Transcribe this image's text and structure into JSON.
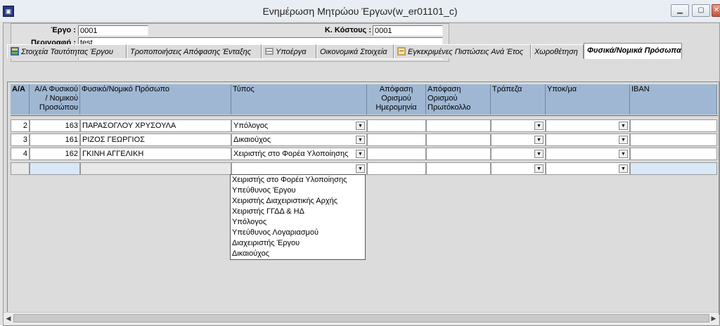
{
  "window": {
    "title": "Ενημέρωση Μητρώου Έργων(w_er01101_c)",
    "app_icon": "app-window-icon",
    "controls": [
      "minimize",
      "maximize",
      "close"
    ]
  },
  "header": {
    "ergo_label": "Έργο :",
    "ergo_value": "0001",
    "kostous_label": "Κ. Κόστους :",
    "kostous_value": "0001",
    "perigrafi_label": "Περιγραφή :",
    "perigrafi_value": "test"
  },
  "tabs": [
    {
      "label": "Στοιχεία Ταυτότητας Έργου",
      "icon": "project-id-icon"
    },
    {
      "label": "Τροποποιήσεις Απόφασης Ένταξης",
      "icon": ""
    },
    {
      "label": "Υποέργα",
      "icon": "subprojects-icon"
    },
    {
      "label": "Οικονομικά Στοιχεία",
      "icon": ""
    },
    {
      "label": "Εγκεκριμένες Πιστώσεις Ανά Έτος",
      "icon": "credits-icon"
    },
    {
      "label": "Χωροθέτηση",
      "icon": ""
    },
    {
      "label": "Φυσικά/Νομικά Πρόσωπα",
      "icon": ""
    }
  ],
  "grid": {
    "columns": [
      "Α/Α",
      "Α/Α Φυσικού / Νομικού Προσώπου",
      "Φυσικό/Νομικό Πρόσωπο",
      "Τύπος",
      "Απόφαση Ορισμού Ημερομηνία",
      "Απόφαση Ορισμού Πρωτόκολλο",
      "Τράπεζα",
      "Υποκ/μα",
      "IBAN"
    ],
    "rows": [
      {
        "aa": "2",
        "aa_prosopou": "163",
        "prosopo": "ΠΑΡΑΣΟΓΛΟΥ ΧΡΥΣΟΥΛΑ",
        "typos": "Υπόλογος"
      },
      {
        "aa": "3",
        "aa_prosopou": "161",
        "prosopo": "ΡΙΖΟΣ ΓΕΩΡΓΙΟΣ",
        "typos": "Δικαιούχος"
      },
      {
        "aa": "4",
        "aa_prosopou": "162",
        "prosopo": "ΓΚΙΝΗ ΑΓΓΕΛΙΚΗ",
        "typos": "Χειριστής στο Φορέα Υλοποίησης"
      },
      {
        "aa": "",
        "aa_prosopou": "",
        "prosopo": "",
        "typos": ""
      }
    ]
  },
  "typos_dropdown": [
    "Χειριστής στο Φορέα Υλοποίησης",
    "Υπεύθυνος Έργου",
    "Χειριστής Διαχειριστικής Αρχής",
    "Χειριστής ΓΓΔΔ & ΗΔ",
    "Υπόλογος",
    "Υπεύθυνος Λογαριασμού",
    "Διαχειριστής Έργου",
    "Δικαιούχος"
  ],
  "colors": {
    "header_bg": "#9fb7d3",
    "new_row_bg": "#d9e8f7"
  }
}
